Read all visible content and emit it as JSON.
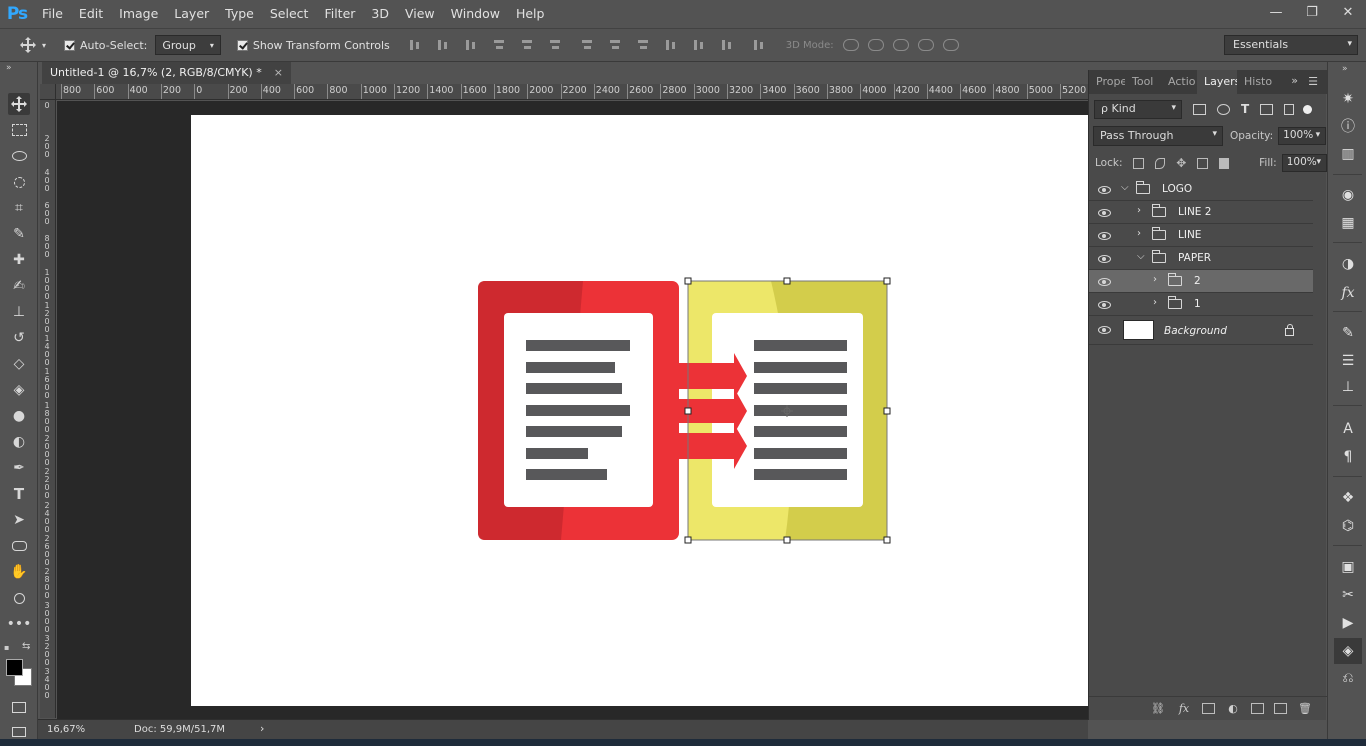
{
  "app": {
    "logo": "Ps",
    "menu": [
      "File",
      "Edit",
      "Image",
      "Layer",
      "Type",
      "Select",
      "Filter",
      "3D",
      "View",
      "Window",
      "Help"
    ]
  },
  "window_controls": {
    "minimize": "—",
    "restore": "❐",
    "close": "✕"
  },
  "options": {
    "auto_select_label": "Auto-Select:",
    "auto_select_value": "Group",
    "transform_label": "Show Transform Controls",
    "mode_3d_label": "3D Mode:",
    "workspace": "Essentials"
  },
  "document": {
    "tab_title": "Untitled-1 @ 16,7% (2, RGB/8/CMYK) *",
    "close_glyph": "×",
    "zoom": "16,67%",
    "doc_size": "Doc: 59,9M/51,7M",
    "status_arrow": "›",
    "ruler_top": [
      "800",
      "600",
      "400",
      "200",
      "0",
      "200",
      "400",
      "600",
      "800",
      "1000",
      "1200",
      "1400",
      "1600",
      "1800",
      "2000",
      "2200",
      "2400",
      "2600",
      "2800",
      "3000",
      "3200",
      "3400",
      "3600",
      "3800",
      "4000",
      "4200",
      "4400",
      "4600",
      "4800",
      "5000",
      "5200"
    ],
    "ruler_left": [
      "0",
      "2\n0\n0",
      "4\n0\n0",
      "6\n0\n0",
      "8\n0\n0",
      "1\n0\n0\n0",
      "1\n2\n0\n0",
      "1\n4\n0\n0",
      "1\n6\n0\n0",
      "1\n8\n0\n0",
      "2\n0\n0\n0",
      "2\n2\n0\n0",
      "2\n4\n0\n0",
      "2\n6\n0\n0",
      "2\n8\n0\n0",
      "3\n0\n0\n0",
      "3\n2\n0\n0",
      "3\n4\n0\n0"
    ]
  },
  "artwork": {
    "colors": {
      "red": "#ec3237",
      "dark_red": "#c4272d",
      "yellow": "#ede769",
      "dark_yellow": "#c8c23e",
      "text_line": "#58585a",
      "paper": "#ffffff"
    }
  },
  "panel": {
    "tabs": [
      "Prope",
      "Tool",
      "Actio",
      "Layers",
      "Histo"
    ],
    "active_tab": "Layers",
    "collapse_glyph": "»",
    "menu_glyph": "☰",
    "kind_label": "ρ Kind",
    "blend_mode": "Pass Through",
    "opacity_label": "Opacity:",
    "opacity_value": "100%",
    "lock_label": "Lock:",
    "fill_label": "Fill:",
    "fill_value": "100%",
    "layers": [
      {
        "name": "LOGO",
        "type": "group",
        "expanded": true,
        "depth": 0,
        "selected": false
      },
      {
        "name": "LINE 2",
        "type": "group",
        "expanded": false,
        "depth": 1,
        "selected": false
      },
      {
        "name": "LINE",
        "type": "group",
        "expanded": false,
        "depth": 1,
        "selected": false
      },
      {
        "name": "PAPER",
        "type": "group",
        "expanded": true,
        "depth": 1,
        "selected": false
      },
      {
        "name": "2",
        "type": "group",
        "expanded": false,
        "depth": 2,
        "selected": true
      },
      {
        "name": "1",
        "type": "group",
        "expanded": false,
        "depth": 2,
        "selected": false
      },
      {
        "name": "Background",
        "type": "background",
        "expanded": false,
        "depth": 0,
        "selected": false
      }
    ],
    "footer_icons": [
      "link-icon",
      "fx-icon",
      "mask-icon",
      "adjustment-icon",
      "folder-icon",
      "new-layer-icon",
      "trash-icon"
    ]
  },
  "icons": {
    "tools": [
      "move-tool-icon",
      "marquee-tool-icon",
      "lasso-tool-icon",
      "quick-select-tool-icon",
      "crop-tool-icon",
      "eyedropper-tool-icon",
      "healing-brush-tool-icon",
      "brush-tool-icon",
      "stamp-tool-icon",
      "history-brush-tool-icon",
      "eraser-tool-icon",
      "paint-bucket-tool-icon",
      "blur-tool-icon",
      "dodge-tool-icon",
      "pen-tool-icon",
      "type-tool-icon",
      "path-select-tool-icon",
      "shape-tool-icon",
      "hand-tool-icon",
      "zoom-tool-icon",
      "more-tools-icon"
    ],
    "dock": [
      "compass-icon",
      "info-icon",
      "histogram-icon",
      "palette-icon",
      "grid-icon",
      "adjust-icon",
      "fx-icon",
      "brush-preset-icon",
      "sliders-icon",
      "clone-source-icon",
      "character-icon",
      "paragraph-icon",
      "3d-icon",
      "path-icon",
      "stamp-icon",
      "tools-icon",
      "play-icon",
      "layers-icon",
      "channels-icon"
    ]
  }
}
